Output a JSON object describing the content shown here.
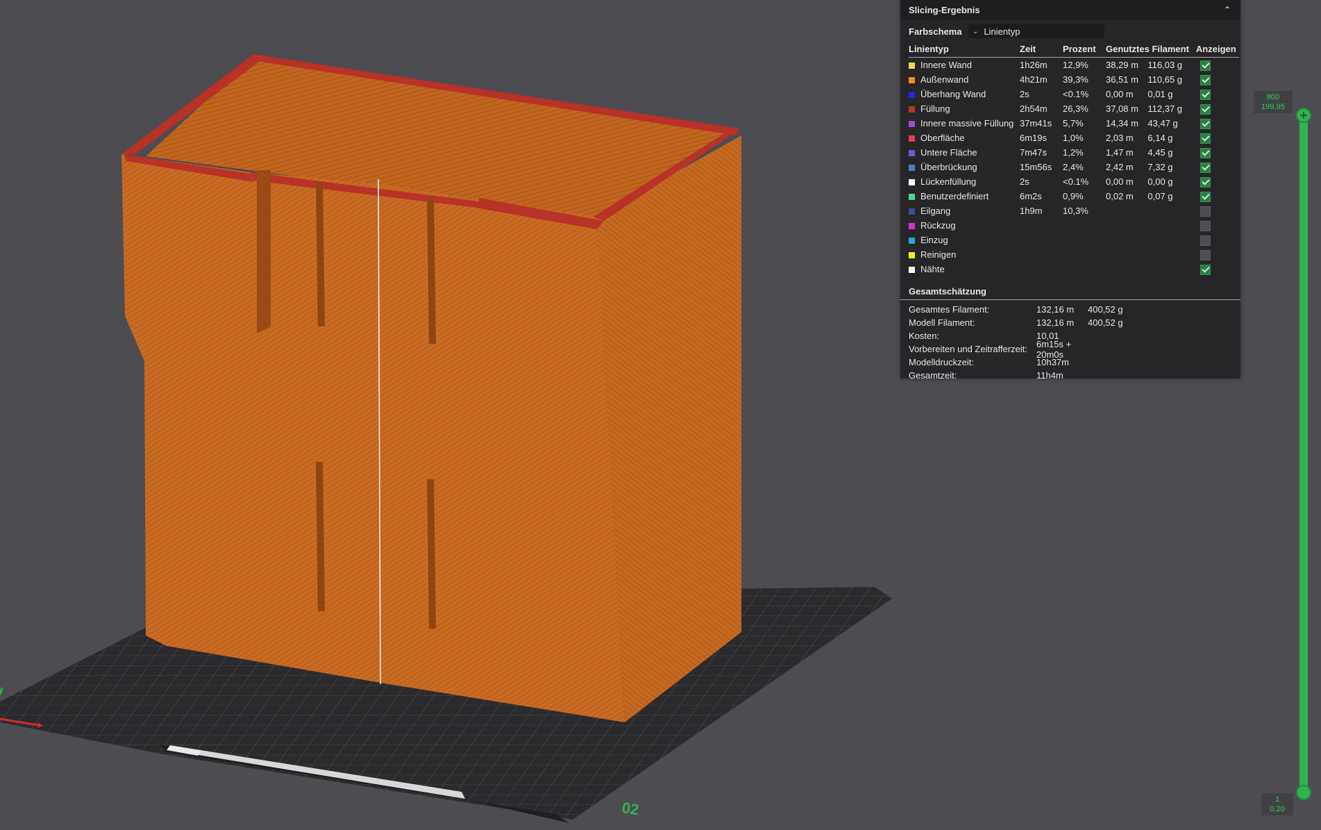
{
  "panel": {
    "title": "Slicing-Ergebnis",
    "color_scheme_label": "Farbschema",
    "color_scheme_value": "Linientyp",
    "columns": [
      "Linientyp",
      "Zeit",
      "Prozent",
      "Genutztes Filament",
      "",
      "Anzeigen"
    ],
    "rows": [
      {
        "name": "Innere Wand",
        "time": "1h26m",
        "percent": "12,9%",
        "length": "38,29 m",
        "weight": "116,03 g",
        "color": "#f0d84a",
        "shown": true
      },
      {
        "name": "Außenwand",
        "time": "4h21m",
        "percent": "39,3%",
        "length": "36,51 m",
        "weight": "110,65 g",
        "color": "#f08b2a",
        "shown": true
      },
      {
        "name": "Überhang Wand",
        "time": "2s",
        "percent": "<0.1%",
        "length": "0,00 m",
        "weight": "0,01 g",
        "color": "#2525e0",
        "shown": true
      },
      {
        "name": "Füllung",
        "time": "2h54m",
        "percent": "26,3%",
        "length": "37,08 m",
        "weight": "112,37 g",
        "color": "#b03a2c",
        "shown": true
      },
      {
        "name": "Innere massive Füllung",
        "time": "37m41s",
        "percent": "5,7%",
        "length": "14,34 m",
        "weight": "43,47 g",
        "color": "#9a4fc9",
        "shown": true
      },
      {
        "name": "Oberfläche",
        "time": "6m19s",
        "percent": "1,0%",
        "length": "2,03 m",
        "weight": "6,14 g",
        "color": "#e0404c",
        "shown": true
      },
      {
        "name": "Untere Fläche",
        "time": "7m47s",
        "percent": "1,2%",
        "length": "1,47 m",
        "weight": "4,45 g",
        "color": "#6a5ed0",
        "shown": true
      },
      {
        "name": "Überbrückung",
        "time": "15m56s",
        "percent": "2,4%",
        "length": "2,42 m",
        "weight": "7,32 g",
        "color": "#4a7fc4",
        "shown": true
      },
      {
        "name": "Lückenfüllung",
        "time": "2s",
        "percent": "<0.1%",
        "length": "0,00 m",
        "weight": "0,00 g",
        "color": "#ffffff",
        "shown": true
      },
      {
        "name": "Benutzerdefiniert",
        "time": "6m2s",
        "percent": "0,9%",
        "length": "0,02 m",
        "weight": "0,07 g",
        "color": "#4fd18d",
        "shown": true
      },
      {
        "name": "Eilgang",
        "time": "1h9m",
        "percent": "10,3%",
        "length": "",
        "weight": "",
        "color": "#3c4e9c",
        "shown": false
      },
      {
        "name": "Rückzug",
        "time": "",
        "percent": "",
        "length": "",
        "weight": "",
        "color": "#d531c8",
        "shown": false
      },
      {
        "name": "Einzug",
        "time": "",
        "percent": "",
        "length": "",
        "weight": "",
        "color": "#2aa6d6",
        "shown": false
      },
      {
        "name": "Reinigen",
        "time": "",
        "percent": "",
        "length": "",
        "weight": "",
        "color": "#f5f01a",
        "shown": false
      },
      {
        "name": "Nähte",
        "time": "",
        "percent": "",
        "length": "",
        "weight": "",
        "color": "#f2f2f2",
        "shown": true
      }
    ],
    "summary_title": "Gesamtschätzung",
    "summary": [
      {
        "label": "Gesamtes Filament:",
        "v1": "132,16 m",
        "v2": "400,52 g"
      },
      {
        "label": "Modell Filament:",
        "v1": "132,16 m",
        "v2": "400,52 g"
      },
      {
        "label": "Kosten:",
        "v1": "10,01",
        "v2": ""
      },
      {
        "label": "Vorbereiten und Zeitrafferzeit:",
        "v1": "6m15s + 20m0s",
        "v2": ""
      },
      {
        "label": "Modelldruckzeit:",
        "v1": "10h37m",
        "v2": ""
      },
      {
        "label": "Gesamtzeit:",
        "v1": "11h4m",
        "v2": ""
      }
    ]
  },
  "slider": {
    "top_layer": "800",
    "top_height": "199,95",
    "bottom_layer": "1",
    "bottom_height": "0,20"
  },
  "plate": {
    "number": "02"
  },
  "colors": {
    "model": "#c86a22",
    "model_dark": "#a85318",
    "rim": "#b83228",
    "plate": "#2b2b2e",
    "slider": "#2fb34f"
  }
}
